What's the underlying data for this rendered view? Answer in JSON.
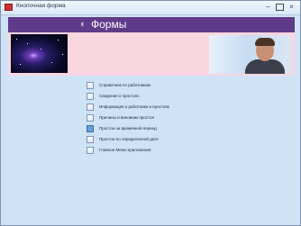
{
  "window": {
    "title": "Кнопочная форма",
    "min_glyph": "–",
    "close_glyph": "×"
  },
  "header": {
    "icon_glyph": "◐",
    "title": "Формы",
    "bg_color": "#5f3b8a",
    "band_color": "#f9d5df"
  },
  "images": {
    "left": "space-nebula-image",
    "right": "man-portrait-image"
  },
  "menu": {
    "items": [
      {
        "label": "Справочник по работникам"
      },
      {
        "label": "Сведения о простоях"
      },
      {
        "label": "Информация о работнике и простоях"
      },
      {
        "label": "Причины и виновник простоя"
      },
      {
        "label": "Простои за временной период",
        "active": true
      },
      {
        "label": "Простои по определенной дате"
      },
      {
        "label": "Главное Меню приложения"
      }
    ]
  }
}
